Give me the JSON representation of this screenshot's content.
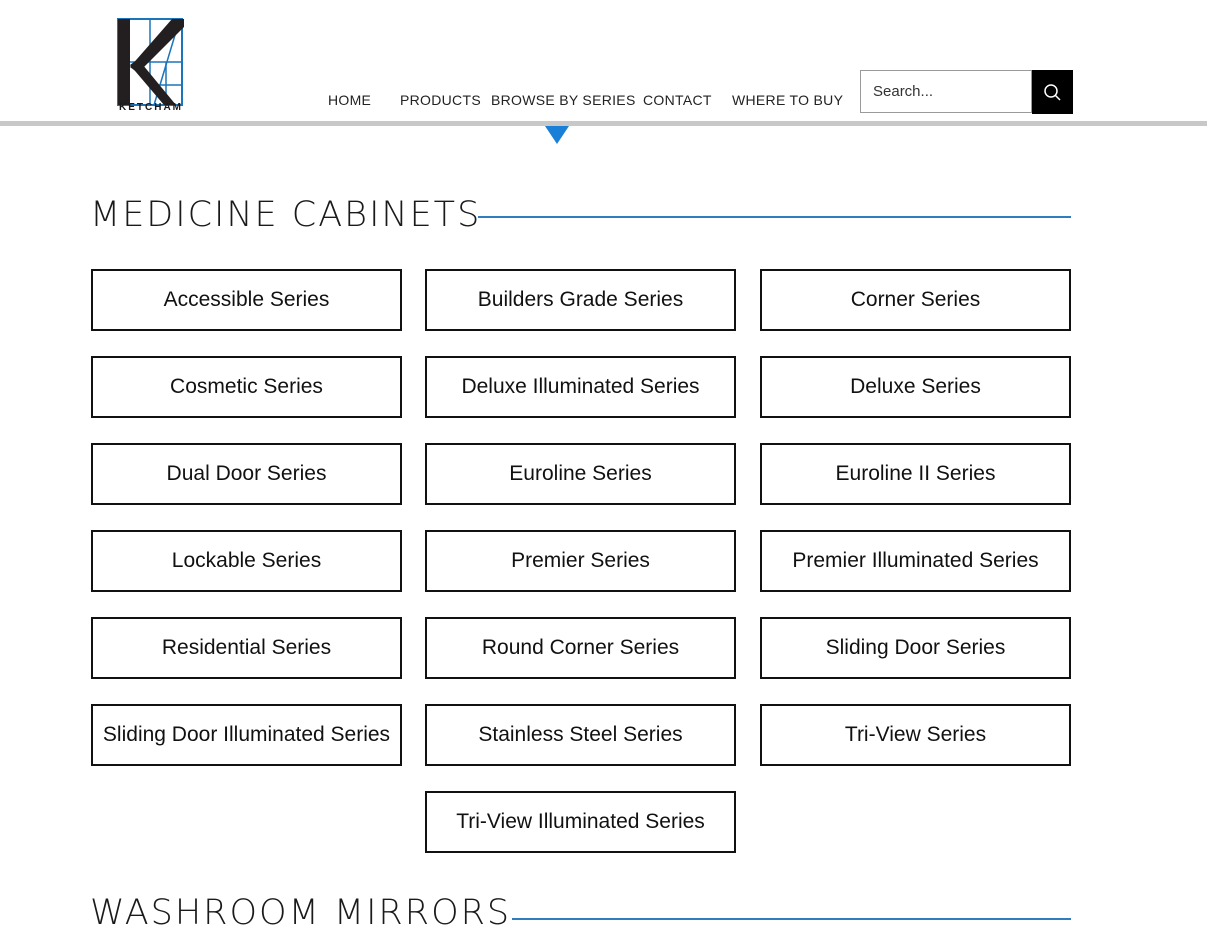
{
  "brand": {
    "logo_text": "KETCHAM"
  },
  "nav": {
    "items": [
      {
        "label": "HOME"
      },
      {
        "label": "PRODUCTS"
      },
      {
        "label": "BROWSE BY SERIES"
      },
      {
        "label": "CONTACT"
      },
      {
        "label": "WHERE TO BUY"
      }
    ],
    "active": "BROWSE BY SERIES"
  },
  "search": {
    "placeholder": "Search..."
  },
  "sections": [
    {
      "title": "MEDICINE CABINETS",
      "series": [
        "Accessible Series",
        "Builders Grade Series",
        "Corner Series",
        "Cosmetic Series",
        "Deluxe Illuminated Series",
        "Deluxe Series",
        "Dual Door Series",
        "Euroline Series",
        "Euroline II Series",
        "Lockable Series",
        "Premier Series",
        "Premier Illuminated Series",
        "Residential Series",
        "Round Corner Series",
        "Sliding Door Series",
        "Sliding Door Illuminated Series",
        "Stainless Steel Series",
        "Tri-View Series",
        "Tri-View Illuminated Series"
      ]
    },
    {
      "title": "WASHROOM MIRRORS"
    }
  ],
  "colors": {
    "accent": "#2f7cc1",
    "indicator": "#1a7fd6",
    "rule": "#c8c8c8",
    "logo_blue": "#1b75bb"
  }
}
